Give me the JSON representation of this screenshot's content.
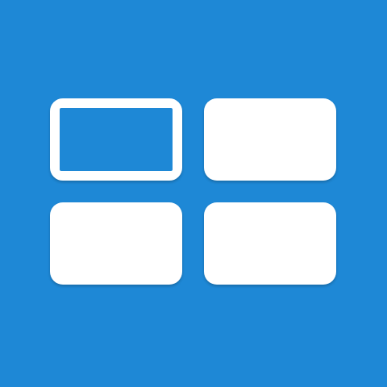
{
  "icon": {
    "name": "grid-layout-icon",
    "background_color": "#1e88d6",
    "tile_color": "#ffffff",
    "tiles": [
      {
        "name": "grid-tile-1",
        "state": "outlined"
      },
      {
        "name": "grid-tile-2",
        "state": "filled"
      },
      {
        "name": "grid-tile-3",
        "state": "filled"
      },
      {
        "name": "grid-tile-4",
        "state": "filled"
      }
    ]
  }
}
